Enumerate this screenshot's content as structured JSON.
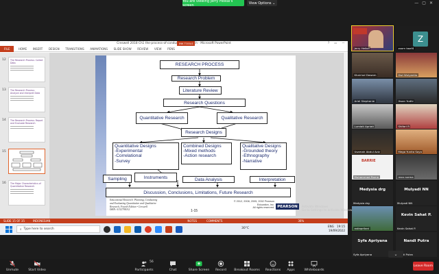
{
  "zoom": {
    "share_banner": "You are viewing Jerry Heikal's screen",
    "view_options": "View Options",
    "toolbar": {
      "unmute": "Unmute",
      "start_video": "Start Video",
      "participants": "Participants",
      "participant_count": "56",
      "chat": "Chat",
      "share_screen": "Share Screen",
      "record": "Record",
      "breakout": "Breakout Rooms",
      "reactions": "Reactions",
      "apps": "Apps",
      "whiteboards": "Whiteboards",
      "leave": "Leave Room"
    },
    "participants": [
      {
        "name": "Jerry Heikal"
      },
      {
        "name": "zoom baaf4"
      },
      {
        "name": "Khairiud Dawam"
      },
      {
        "name": "Dwi Wulyantio"
      },
      {
        "name": "Ariel Stephanie"
      },
      {
        "name": "Ihsan Yudhi"
      },
      {
        "name": "Lumiati Apriati"
      },
      {
        "name": "Shifari R"
      },
      {
        "name": "Usamah Abdul Aziz"
      },
      {
        "name": "Mega Yunita Sayo"
      },
      {
        "name": "Muhammad Rama"
      },
      {
        "name": "reza norma"
      },
      {
        "name": "Medysia drg",
        "label": "Medysia drg"
      },
      {
        "name": "Mulyadi NN",
        "label": "Mulyadi NN"
      },
      {
        "name": "astiaprilani"
      },
      {
        "name": "Kevin Sahat P.",
        "label": "Kevin Sahat P."
      },
      {
        "name": "Syfa Apriyana",
        "label": "Syfa Apriyana"
      },
      {
        "name": "Nandi Putra",
        "label": "Nandi Putra"
      }
    ],
    "tile_labels": {
      "z_letter": "Z",
      "baruk": "BARRIE"
    }
  },
  "powerpoint": {
    "title": "Creswell 2018 Ch1 the-process-of-conducting-research - Microsoft PowerPoint",
    "tools_tab": "INK TOOLS",
    "sign_in": "Sign in",
    "tabs": [
      "FILE",
      "HOME",
      "INSERT",
      "DESIGN",
      "TRANSITIONS",
      "ANIMATIONS",
      "SLIDE SHOW",
      "REVIEW",
      "VIEW",
      "PENS"
    ],
    "thumbs": [
      {
        "num": "12",
        "title": "The Research Process: Collect Data"
      },
      {
        "num": "13",
        "title": "The Research Process: Analyze and Interpret Data"
      },
      {
        "num": "14",
        "title": "The Research Process: Report and Evaluate Research"
      },
      {
        "num": "15",
        "title": ""
      },
      {
        "num": "16",
        "title": "The Major Characteristics of Quantitative Research"
      }
    ],
    "status": {
      "slide": "SLIDE 15 OF 35",
      "language": "INDONESIAN",
      "notes": "NOTES",
      "comments": "COMMENTS",
      "zoom": "36%"
    },
    "activate": [
      "Activate Windows",
      "Go to Settings to activate Windows."
    ]
  },
  "slide": {
    "title": "RESEARCH PROCESS",
    "problem": "Research Problem",
    "literature": "Literature Review",
    "questions": "Research Questions",
    "quant_research": "Quantitative Research",
    "qual_research": "Qualitative Research",
    "designs": "Research Designs",
    "quant_designs": [
      "Quantitative Designs",
      "-Experimental",
      "-Correlational",
      "-Survey"
    ],
    "combined_designs": [
      "Combined Designs",
      "-Mixed methods",
      "-Action research"
    ],
    "qual_designs": [
      "Qualitative Designs",
      "-Grounded theory",
      "-Ethnography",
      "-Narrative"
    ],
    "sampling": "Sampling",
    "instruments": "Instruments",
    "data_analysis": "Data Analysis",
    "interpretation": "Interpretation",
    "discussion": "Discussion, Conclusions, Limitations, Future Research",
    "citation": [
      "Educational Research: Planning, Conducting",
      "and Evaluating Quantitative and Qualitative",
      "Research, Fourth Edition • Creswell",
      "ISBN: 0132795012"
    ],
    "page": "1-15",
    "copyright": [
      "© 2012, 2008, 2005, 2002 Pearson",
      "Education, Inc.",
      "All rights reserved."
    ],
    "publisher": "PEARSON"
  },
  "windows": {
    "search_placeholder": "Type here to search",
    "weather": "30°C",
    "lang": "ENG",
    "time": "19:15",
    "date": "19/09/2022"
  }
}
